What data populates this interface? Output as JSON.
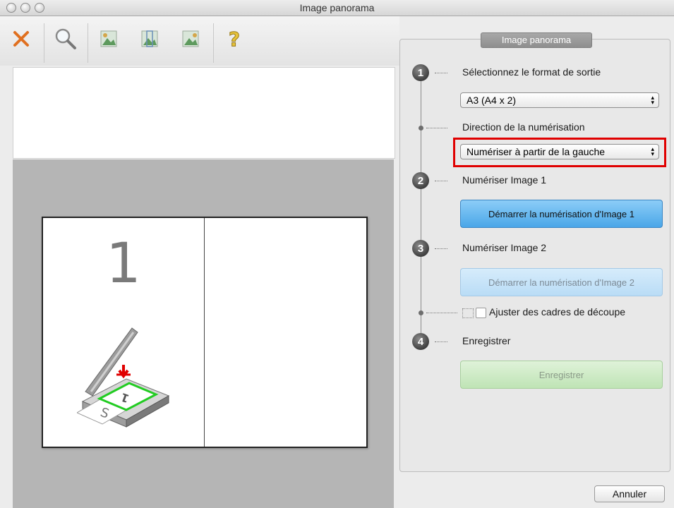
{
  "window": {
    "title": "Image panorama"
  },
  "toolbar": {
    "tools": [
      {
        "name": "delete-icon",
        "label": "×"
      },
      {
        "name": "zoom-icon"
      },
      {
        "name": "arrange-left-icon"
      },
      {
        "name": "arrange-middle-icon"
      },
      {
        "name": "arrange-right-icon"
      },
      {
        "name": "help-icon",
        "label": "?"
      }
    ]
  },
  "preview": {
    "page_number": "1"
  },
  "panel": {
    "title": "Image panorama",
    "steps": {
      "one": "1",
      "two": "2",
      "three": "3",
      "four": "4"
    },
    "output_format_label": "Sélectionnez le format de sortie",
    "output_format_value": "A3 (A4 x 2)",
    "scan_direction_label": "Direction de la numérisation",
    "scan_direction_value": "Numériser à partir de la gauche",
    "scan_image1_label": "Numériser Image 1",
    "scan_image1_button": "Démarrer la numérisation d'Image 1",
    "scan_image2_label": "Numériser Image 2",
    "scan_image2_button": "Démarrer la numérisation d'Image 2",
    "crop_frames_label": "Ajuster des cadres de découpe",
    "save_label": "Enregistrer",
    "save_button": "Enregistrer"
  },
  "footer": {
    "cancel_button": "Annuler"
  },
  "colors": {
    "accent_blue": "#67b6ef",
    "save_green": "#c8e8c0",
    "highlight_red": "#e00000"
  }
}
